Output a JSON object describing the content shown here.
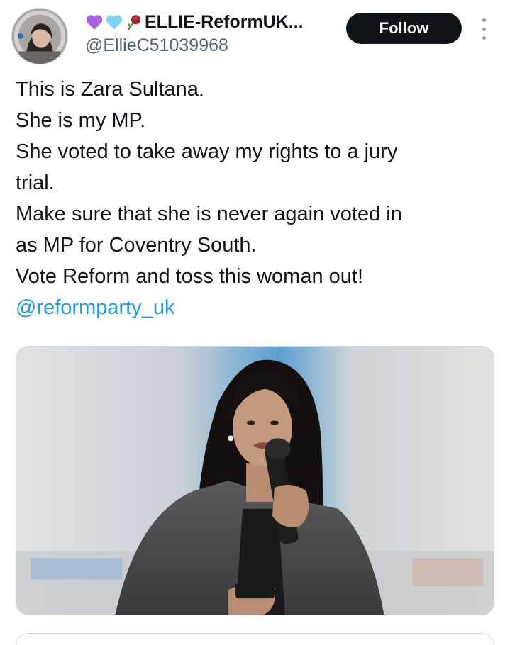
{
  "user": {
    "display_name": "ELLIE-ReformUK...",
    "emojis": [
      "purple-heart-icon",
      "light-blue-heart-icon",
      "wilted-rose-icon"
    ],
    "handle": "@EllieC51039968"
  },
  "follow_button": {
    "label": "Follow"
  },
  "tweet": {
    "lines": [
      "This is Zara Sultana.",
      "She is my MP.",
      "She voted to take away my rights to a jury",
      "trial.",
      "Make sure that she is never again voted in",
      "as MP for Coventry South.",
      "Vote Reform and toss this woman out!"
    ],
    "mention": "@reformparty_uk"
  },
  "colors": {
    "accent": "#1d9bf0",
    "follow_bg": "#0f1419",
    "text": "#0f1419",
    "secondary": "#536471"
  }
}
